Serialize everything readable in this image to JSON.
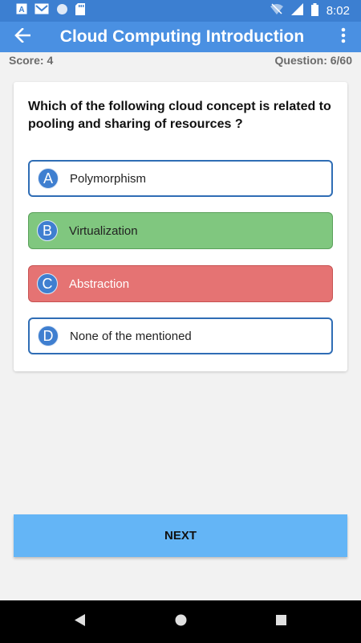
{
  "status_bar": {
    "time": "8:02",
    "left_icons": [
      "a-icon",
      "gmail-icon",
      "circle-icon",
      "sd-card-icon"
    ],
    "right_icons": [
      "wifi-icon",
      "signal-icon",
      "battery-icon"
    ]
  },
  "app_bar": {
    "title": "Cloud Computing Introduction",
    "back_icon": "arrow-back-icon",
    "menu_icon": "more-vert-icon"
  },
  "quiz": {
    "score_label": "Score: 4",
    "question_label": "Question: 6/60",
    "question_text": "Which of the following cloud concept is related to pooling and sharing of resources ?",
    "options": [
      {
        "letter": "A",
        "text": "Polymorphism",
        "state": "default"
      },
      {
        "letter": "B",
        "text": "Virtualization",
        "state": "correct"
      },
      {
        "letter": "C",
        "text": "Abstraction",
        "state": "wrong"
      },
      {
        "letter": "D",
        "text": "None of the mentioned",
        "state": "default"
      }
    ],
    "next_label": "NEXT"
  },
  "colors": {
    "status_bar": "#3c7fd1",
    "app_bar": "#4a90e2",
    "correct": "#80c77f",
    "wrong": "#e57373",
    "next_button": "#64b5f6"
  },
  "nav_bar": {
    "icons": [
      "back-triangle-icon",
      "home-circle-icon",
      "recents-square-icon"
    ]
  }
}
